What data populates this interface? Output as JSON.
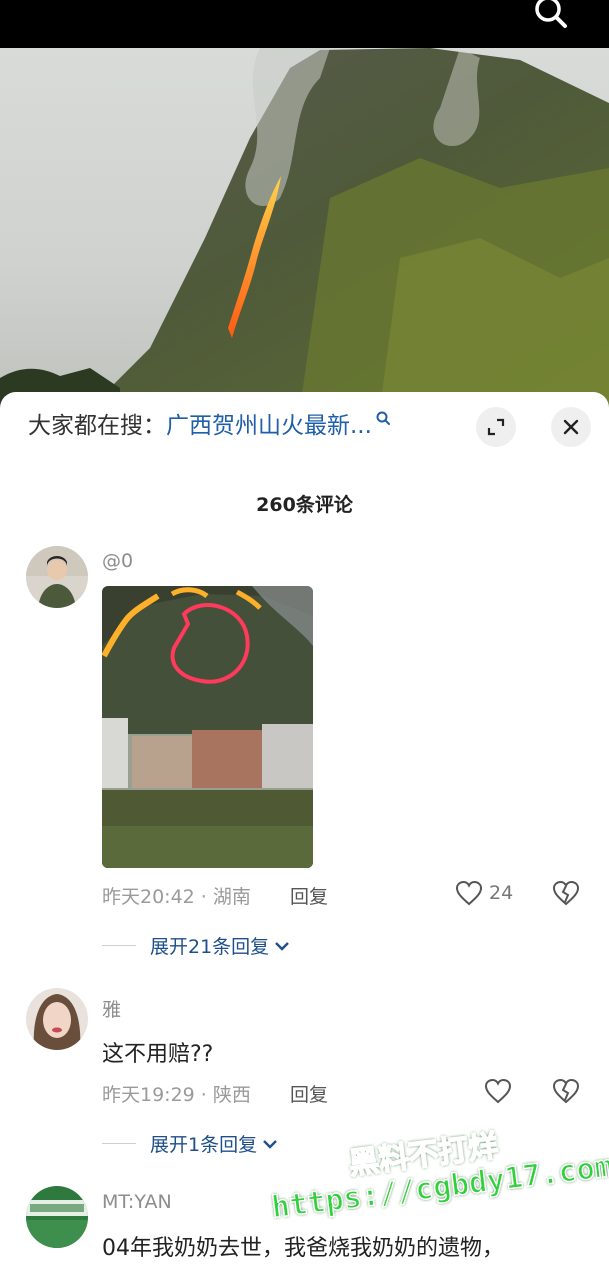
{
  "search": {
    "prefix": "大家都在搜：",
    "query": "广西贺州山火最新..."
  },
  "comments_header": {
    "count_label": "260条评论"
  },
  "comments": [
    {
      "username": "@0",
      "text": "",
      "time_location": "昨天20:42 · 湖南",
      "reply_label": "回复",
      "like_count": "24",
      "expand_label": "展开21条回复"
    },
    {
      "username": "雅",
      "text": "这不用赔??",
      "time_location": "昨天19:29 · 陕西",
      "reply_label": "回复",
      "like_count": "",
      "expand_label": "展开1条回复"
    },
    {
      "username": "MT:YAN",
      "text": "04年我奶奶去世，我爸烧我奶奶的遗物，"
    }
  ],
  "watermark": {
    "line1": "黑料不打烊",
    "line2": "https://cgbdy17.com"
  },
  "icons": {
    "top_search": "search-icon",
    "search_suggest": "search-small-icon",
    "expand": "expand-icon",
    "close": "close-icon",
    "like": "heart-icon",
    "dislike": "broken-heart-icon",
    "chevron": "chevron-down-icon"
  },
  "colors": {
    "accent_blue": "#1f5ea8",
    "watermark_green": "#2fd13a"
  }
}
